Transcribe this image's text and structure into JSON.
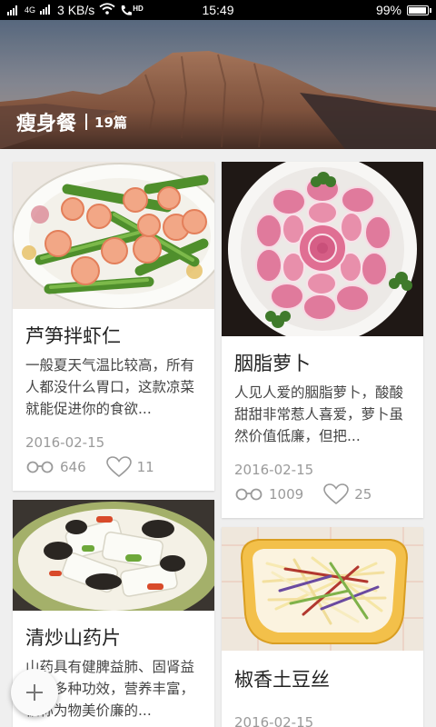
{
  "status_bar": {
    "network_speed": "3 KB/s",
    "signal_label": "4G",
    "hd_label": "HD",
    "time": "15:49",
    "battery_text": "99%",
    "battery_level": 0.99
  },
  "header": {
    "title": "瘦身餐",
    "count": "19篇"
  },
  "recipes": [
    {
      "title": "芦笋拌虾仁",
      "description": "一般夏天气温比较高，所有人都没什么胃口，这款凉菜就能促进你的食欲...",
      "date": "2016-02-15",
      "views": "646",
      "likes": "11"
    },
    {
      "title": "胭脂萝卜",
      "description": "人见人爱的胭脂萝卜，酸酸甜甜非常惹人喜爱，萝卜虽然价值低廉，但把...",
      "date": "2016-02-15",
      "views": "1009",
      "likes": "25"
    },
    {
      "title": "清炒山药片",
      "description": "山药具有健脾益肺、固肾益精等多种功效，营养丰富，被称为物美价廉的...",
      "date": "",
      "views": "",
      "likes": ""
    },
    {
      "title": "椒香土豆丝",
      "description": "",
      "date": "2016-02-15",
      "views": "",
      "likes": ""
    }
  ],
  "icons": {
    "views": "glasses-icon",
    "likes": "heart-icon",
    "fab": "plus-icon"
  }
}
